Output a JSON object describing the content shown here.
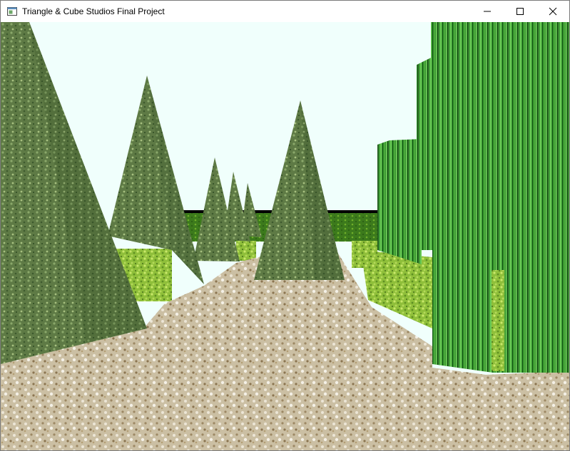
{
  "window": {
    "title": "Triangle & Cube Studios Final Project",
    "icon": "window-app-icon",
    "controls": [
      "minimize-icon",
      "maximize-icon",
      "close-icon"
    ]
  },
  "scene": {
    "description_type": "3D OpenGL render",
    "sky_color": "#f0fffc",
    "objects": [
      "stone-path",
      "hedge-walls",
      "pyramid-trees",
      "green-cylinders"
    ]
  },
  "colors": {
    "sky": "#f0fffc",
    "path": "#cbbfa3",
    "hedge": "#8fbf3a",
    "pyramid": "#5e7a45",
    "cylinder": "#2f8f2a"
  }
}
